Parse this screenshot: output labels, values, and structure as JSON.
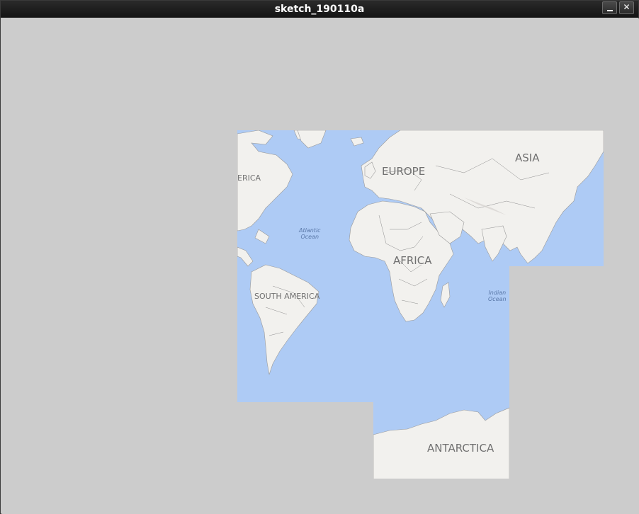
{
  "window": {
    "title": "sketch_190110a",
    "minimize_label": "minimize",
    "close_glyph": "✕"
  },
  "map": {
    "continents": {
      "north_america": "ERICA",
      "europe": "EUROPE",
      "asia": "ASIA",
      "africa": "AFRICA",
      "south_america": "SOUTH AMERICA",
      "antarctica": "ANTARCTICA"
    },
    "oceans": {
      "atlantic": "Atlantic\nOcean",
      "indian": "Indian\nOcean"
    },
    "colors": {
      "ocean": "#aecbf5",
      "land": "#f2f1ee",
      "border": "#8c8c8c",
      "background": "#cccccc"
    }
  }
}
